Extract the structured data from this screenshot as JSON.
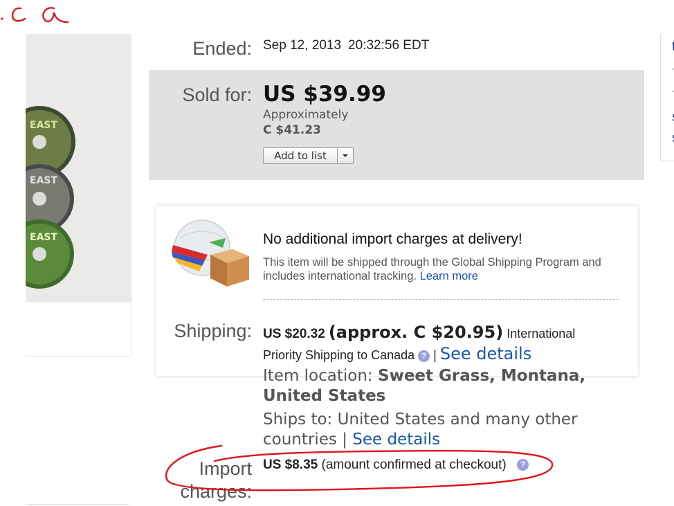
{
  "annotations": {
    "scribble_text": ".ca",
    "ink_color": "#e0141b"
  },
  "ended": {
    "label": "Ended:",
    "date": "Sep 12, 2013",
    "time": "20:32:56 EDT"
  },
  "sold": {
    "label": "Sold for:",
    "price": "US $39.99",
    "approx_label": "Approximately",
    "approx_value": "C $41.23",
    "add_to_list": "Add to list",
    "panel_color": "#e1e1e1"
  },
  "gsp": {
    "heading": "No additional import charges at delivery!",
    "body": "This item will be shipped through the Global Shipping Program and includes international tracking.",
    "learn_more": "Learn more"
  },
  "shipping": {
    "label": "Shipping:",
    "cost": "US $20.32",
    "approx": "(approx. C $20.95)",
    "service_pre": "International",
    "service_post": "Priority Shipping to Canada",
    "separator": "|",
    "see_details": "See details",
    "item_location_label": "Item location:",
    "item_location_value": "Sweet Grass, Montana, United States",
    "ships_to": "Ships to: United States and many other countries",
    "ships_to_separator": "|",
    "ships_to_see_details": "See details",
    "help_glyph": "?"
  },
  "import_charges": {
    "label_line1": "Import",
    "label_line2": "charges:",
    "value": "US $8.35",
    "note": "(amount confirmed at checkout)",
    "help_glyph": "?"
  },
  "link_color": "#1a56b0"
}
